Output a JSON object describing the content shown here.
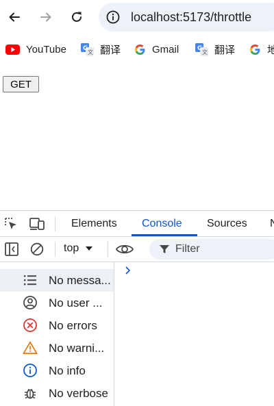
{
  "browser": {
    "url": "localhost:5173/throttle",
    "nav": {
      "back_icon": "arrow-left",
      "forward_icon": "arrow-right",
      "reload_icon": "reload"
    }
  },
  "bookmarks": [
    {
      "label": "YouTube",
      "icon": "youtube-icon"
    },
    {
      "label": "翻译",
      "icon": "google-translate-icon"
    },
    {
      "label": "Gmail",
      "icon": "google-icon"
    },
    {
      "label": "翻译",
      "icon": "google-translate-icon"
    },
    {
      "label": "地",
      "icon": "google-icon"
    }
  ],
  "page": {
    "get_button_label": "GET"
  },
  "devtools": {
    "tabs": [
      {
        "label": "Elements",
        "active": false
      },
      {
        "label": "Console",
        "active": true
      },
      {
        "label": "Sources",
        "active": false
      },
      {
        "label": "N",
        "active": false
      }
    ],
    "context": "top",
    "filter_placeholder": "Filter",
    "sidebar": [
      {
        "label": "No messa...",
        "icon": "list-icon",
        "selected": true
      },
      {
        "label": "No user ...",
        "icon": "user-icon",
        "selected": false
      },
      {
        "label": "No errors",
        "icon": "error-icon",
        "selected": false
      },
      {
        "label": "No warni...",
        "icon": "warning-icon",
        "selected": false
      },
      {
        "label": "No info",
        "icon": "info-icon",
        "selected": false
      },
      {
        "label": "No verbose",
        "icon": "bug-icon",
        "selected": false
      }
    ],
    "colors": {
      "accent": "#0b57d0",
      "error": "#dc362e",
      "warning": "#e37400",
      "info": "#0b57d0"
    }
  }
}
